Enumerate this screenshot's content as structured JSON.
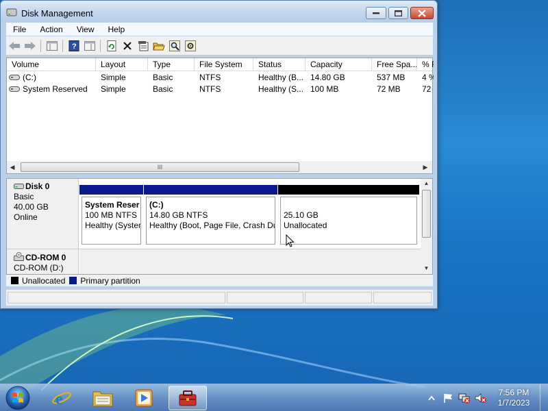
{
  "window": {
    "title": "Disk Management"
  },
  "menu": [
    "File",
    "Action",
    "View",
    "Help"
  ],
  "columns": [
    "Volume",
    "Layout",
    "Type",
    "File System",
    "Status",
    "Capacity",
    "Free Spa...",
    "% F"
  ],
  "volumes": [
    {
      "volume": "(C:)",
      "layout": "Simple",
      "type": "Basic",
      "fs": "NTFS",
      "status": "Healthy (B...",
      "capacity": "14.80 GB",
      "free": "537 MB",
      "pct": "4 %"
    },
    {
      "volume": "System Reserved",
      "layout": "Simple",
      "type": "Basic",
      "fs": "NTFS",
      "status": "Healthy (S...",
      "capacity": "100 MB",
      "free": "72 MB",
      "pct": "72"
    }
  ],
  "hscroll_grip": "III",
  "disks": [
    {
      "name": "Disk 0",
      "kind": "Basic",
      "size": "40.00 GB",
      "state": "Online",
      "partitions": [
        {
          "title": "System Reser",
          "line1": "100 MB NTFS",
          "line2": "Healthy (Syster",
          "kind": "primary"
        },
        {
          "title": "(C:)",
          "line1": "14.80 GB NTFS",
          "line2": "Healthy (Boot, Page File, Crash Du",
          "kind": "primary"
        },
        {
          "title": "",
          "line1": "25.10 GB",
          "line2": "Unallocated",
          "kind": "unallocated"
        }
      ]
    },
    {
      "name": "CD-ROM 0",
      "kind": "CD-ROM (D:)"
    }
  ],
  "legend": [
    {
      "label": "Unallocated",
      "color": "#000000"
    },
    {
      "label": "Primary partition",
      "color": "#00008b"
    }
  ],
  "colors": {
    "primary_bar": "#0a1a8c",
    "unallocated_bar": "#000000",
    "titlebar": "#c4d8ee"
  },
  "taskbar": {
    "apps": [
      "internet-explorer-icon",
      "windows-explorer-icon",
      "media-player-icon",
      "computer-management-icon"
    ],
    "time": "7:56 PM",
    "date": "1/7/2023"
  }
}
